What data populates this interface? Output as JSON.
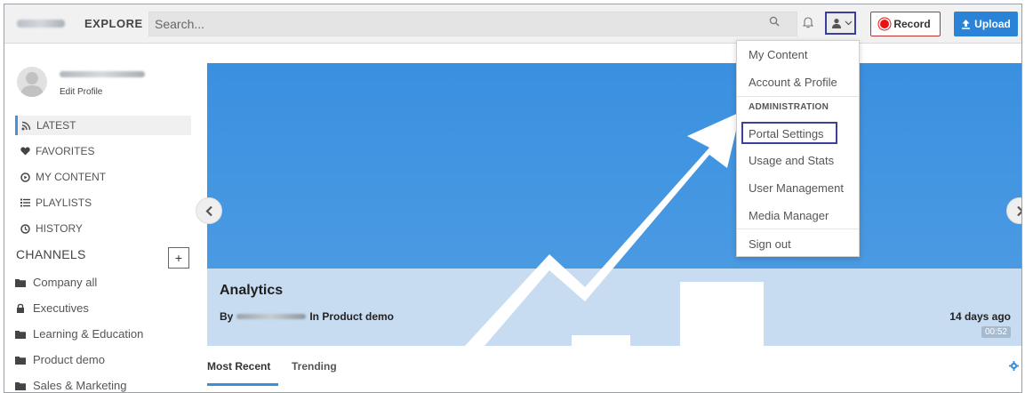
{
  "header": {
    "explore_label": "EXPLORE",
    "search_placeholder": "Search...",
    "record_label": "Record",
    "upload_label": "Upload"
  },
  "profile": {
    "edit_label": "Edit Profile"
  },
  "sidebar": {
    "nav": [
      {
        "label": "LATEST",
        "icon": "rss-icon",
        "active": true
      },
      {
        "label": "FAVORITES",
        "icon": "heart-icon",
        "active": false
      },
      {
        "label": "MY CONTENT",
        "icon": "play-circle-icon",
        "active": false
      },
      {
        "label": "PLAYLISTS",
        "icon": "list-icon",
        "active": false
      },
      {
        "label": "HISTORY",
        "icon": "clock-icon",
        "active": false
      }
    ],
    "channels_heading": "CHANNELS",
    "add_channel_label": "+",
    "channels": [
      {
        "label": "Company all",
        "icon": "folder-icon"
      },
      {
        "label": "Executives",
        "icon": "lock-icon"
      },
      {
        "label": "Learning & Education",
        "icon": "folder-icon"
      },
      {
        "label": "Product demo",
        "icon": "folder-icon"
      },
      {
        "label": "Sales & Marketing",
        "icon": "folder-icon"
      }
    ]
  },
  "hero": {
    "title": "Analytics",
    "by_prefix": "By",
    "in_channel": "In Product demo",
    "age": "14 days ago",
    "duration": "00:52"
  },
  "tabs": [
    {
      "label": "Most Recent",
      "active": true
    },
    {
      "label": "Trending",
      "active": false
    }
  ],
  "user_menu": {
    "items_top": [
      "My Content",
      "Account & Profile"
    ],
    "admin_header": "ADMINISTRATION",
    "admin_items": [
      "Portal Settings",
      "Usage and Stats",
      "User Management",
      "Media Manager"
    ],
    "signout": "Sign out",
    "highlighted": "Portal Settings"
  },
  "colors": {
    "accent": "#2a83d6",
    "hero_blue": "#3a90e0",
    "hero_light": "#c7dcf1",
    "highlight_box": "#3b3f9e",
    "record_red": "#e11111"
  }
}
